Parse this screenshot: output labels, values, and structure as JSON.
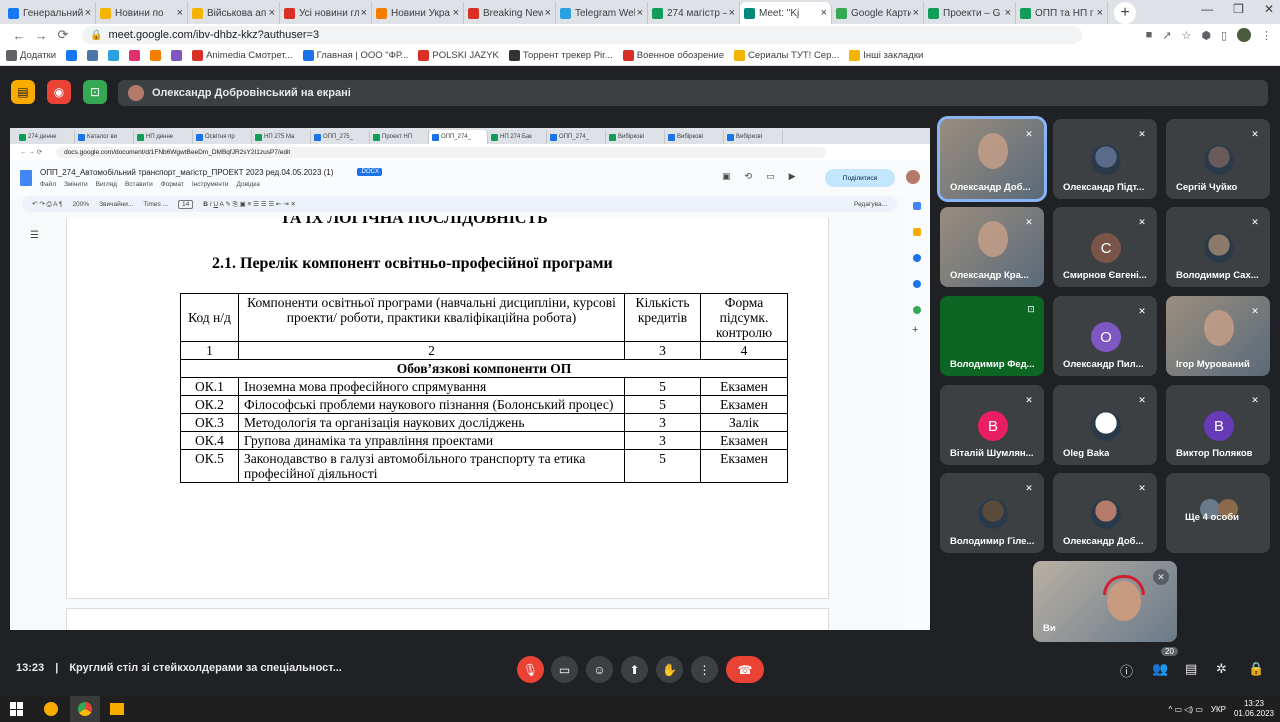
{
  "browser": {
    "tabs": [
      {
        "title": "Генеральний",
        "color": "#1877f2"
      },
      {
        "title": "Новини по",
        "color": "#f4b400"
      },
      {
        "title": "Військова ап",
        "color": "#f4b400"
      },
      {
        "title": "Усі новини гл",
        "color": "#d93025"
      },
      {
        "title": "Новини Укра",
        "color": "#f57c00"
      },
      {
        "title": "Breaking New",
        "color": "#d93025"
      },
      {
        "title": "Telegram Wel",
        "color": "#2aa1e0"
      },
      {
        "title": "274 магістр –",
        "color": "#0f9d58"
      },
      {
        "title": "Meet: \"Kj",
        "color": "#00897b",
        "active": true
      },
      {
        "title": "Google Карти",
        "color": "#34a853"
      },
      {
        "title": "Проекти – G",
        "color": "#0f9d58"
      },
      {
        "title": "ОПП та НП г",
        "color": "#0f9d58"
      }
    ],
    "url": "meet.google.com/ibv-dhbz-kkz?authuser=3",
    "bookmarks": [
      {
        "label": "Додатки",
        "color": "#5f6368"
      },
      {
        "label": "",
        "color": "#1877f2"
      },
      {
        "label": "",
        "color": "#4a76a8"
      },
      {
        "label": "",
        "color": "#2aa1e0"
      },
      {
        "label": "",
        "color": "#e1306c"
      },
      {
        "label": "",
        "color": "#f57c00"
      },
      {
        "label": "",
        "color": "#7e57c2"
      },
      {
        "label": "Animedia Смотрет...",
        "color": "#d93025"
      },
      {
        "label": "Главная | ООО \"ФР...",
        "color": "#1a73e8"
      },
      {
        "label": "POLSKI JAZYK",
        "color": "#d93025"
      },
      {
        "label": "Торрент трекер Pir...",
        "color": "#333333"
      },
      {
        "label": "Военное обозрение",
        "color": "#d93025"
      },
      {
        "label": "Сериалы ТУТ! Сер...",
        "color": "#f4b400"
      },
      {
        "label": "Інші закладки",
        "color": "#f4b400"
      }
    ]
  },
  "meet": {
    "presenting_banner": "Олександр Добровінський на екрані",
    "clock": "13:23",
    "meeting_title": "Круглий стіл зі стейкхолдерами за спеціальност...",
    "participant_count": "20",
    "participants": [
      {
        "name": "Олександр Доб...",
        "type": "photo",
        "active": true
      },
      {
        "name": "Олександр Підт...",
        "type": "avatar-photo",
        "color": "#5a6a8a"
      },
      {
        "name": "Сергій Чуйко",
        "type": "avatar-photo",
        "color": "#6a5a5a"
      },
      {
        "name": "Олександр Кра...",
        "type": "photo"
      },
      {
        "name": "Смирнов Євгені...",
        "type": "letter",
        "letter": "С",
        "color": "#795548"
      },
      {
        "name": "Володимир Сах...",
        "type": "avatar-photo",
        "color": "#8a7a6a"
      },
      {
        "name": "Володимир Фед...",
        "type": "green"
      },
      {
        "name": "Олександр Пил...",
        "type": "letter",
        "letter": "О",
        "color": "#7e57c2"
      },
      {
        "name": "Ігор Мурований",
        "type": "photo"
      },
      {
        "name": "Віталій Шумлян...",
        "type": "letter",
        "letter": "В",
        "color": "#e91e63"
      },
      {
        "name": "Oleg Baka",
        "type": "avatar-photo",
        "color": "#ffffff"
      },
      {
        "name": "Виктор Поляков",
        "type": "letter",
        "letter": "В",
        "color": "#673ab7"
      },
      {
        "name": "Володимир Гіле...",
        "type": "avatar-photo",
        "color": "#5a4a3a"
      },
      {
        "name": "Олександр Доб...",
        "type": "avatar-photo",
        "color": "#b47a6a"
      },
      {
        "name": "Ще 4 особи",
        "type": "more"
      }
    ],
    "self_name": "Ви"
  },
  "shared": {
    "tabs": [
      "274 денне",
      "Каталог ви",
      "НП денне",
      "Освітня пр",
      "НП 275 Ма",
      "ОПП_275_",
      "Проект НП",
      "ОПП_274_",
      "НП 274 Бак",
      "ОПП_274_",
      "Вибіркові",
      "Вибіркові",
      "Вибіркові"
    ],
    "url": "docs.google.com/document/d/1FNb6WgwtBeeDm_DMBqfJR2sY2I1zusP7/edit",
    "doc_name": "ОПП_274_Автомобільний транспорт_магістр_ПРОЕКТ 2023 ред.04.05.2023 (1)",
    "docx_badge": ".DOCX",
    "menus": [
      "Файл",
      "Змінити",
      "Вигляд",
      "Вставити",
      "Формат",
      "Інструменти",
      "Довідка"
    ],
    "share_label": "Поділитися",
    "zoom": "200%",
    "style": "Звичайни...",
    "font": "Times ...",
    "font_size": "14",
    "editing": "Редагува...",
    "cut_title": "ТА ЇХ ЛОГІЧНА ПОСЛІДОВНІСТЬ",
    "section_title": "2.1. Перелік компонент освітньо-професійної програми",
    "table": {
      "headers": [
        "Код н/д",
        "Компоненти освітньої програми (навчальні дисципліни, курсові проекти/ роботи, практики кваліфікаційна робота)",
        "Кількість кредитів",
        "Форма підсумк. контролю"
      ],
      "numbering": [
        "1",
        "2",
        "3",
        "4"
      ],
      "group": "Обов’язкові компоненти ОП",
      "rows": [
        {
          "code": "ОК.1",
          "name": "Іноземна мова професійного спрямування",
          "credits": "5",
          "form": "Екзамен"
        },
        {
          "code": "ОК.2",
          "name": "Філософські проблеми наукового пізнання (Болонський процес)",
          "credits": "5",
          "form": "Екзамен"
        },
        {
          "code": "ОК.3",
          "name": "Методологія та організація наукових досліджень",
          "credits": "3",
          "form": "Залік"
        },
        {
          "code": "ОК.4",
          "name": "Групова динаміка та управління проектами",
          "credits": "3",
          "form": "Екзамен"
        },
        {
          "code": "ОК.5",
          "name": "Законодавство в галузі автомобільного транспорту та етика професійної діяльності",
          "credits": "5",
          "form": "Екзамен"
        }
      ]
    }
  },
  "taskbar": {
    "lang": "УКР",
    "time": "13:23",
    "date": "01.06.2023"
  },
  "icons": {
    "mic_off": "mic-off-icon",
    "camera": "camera-icon",
    "emoji": "emoji-icon",
    "present": "present-icon",
    "hand": "raise-hand-icon",
    "more": "more-icon",
    "hangup": "hangup-icon"
  }
}
